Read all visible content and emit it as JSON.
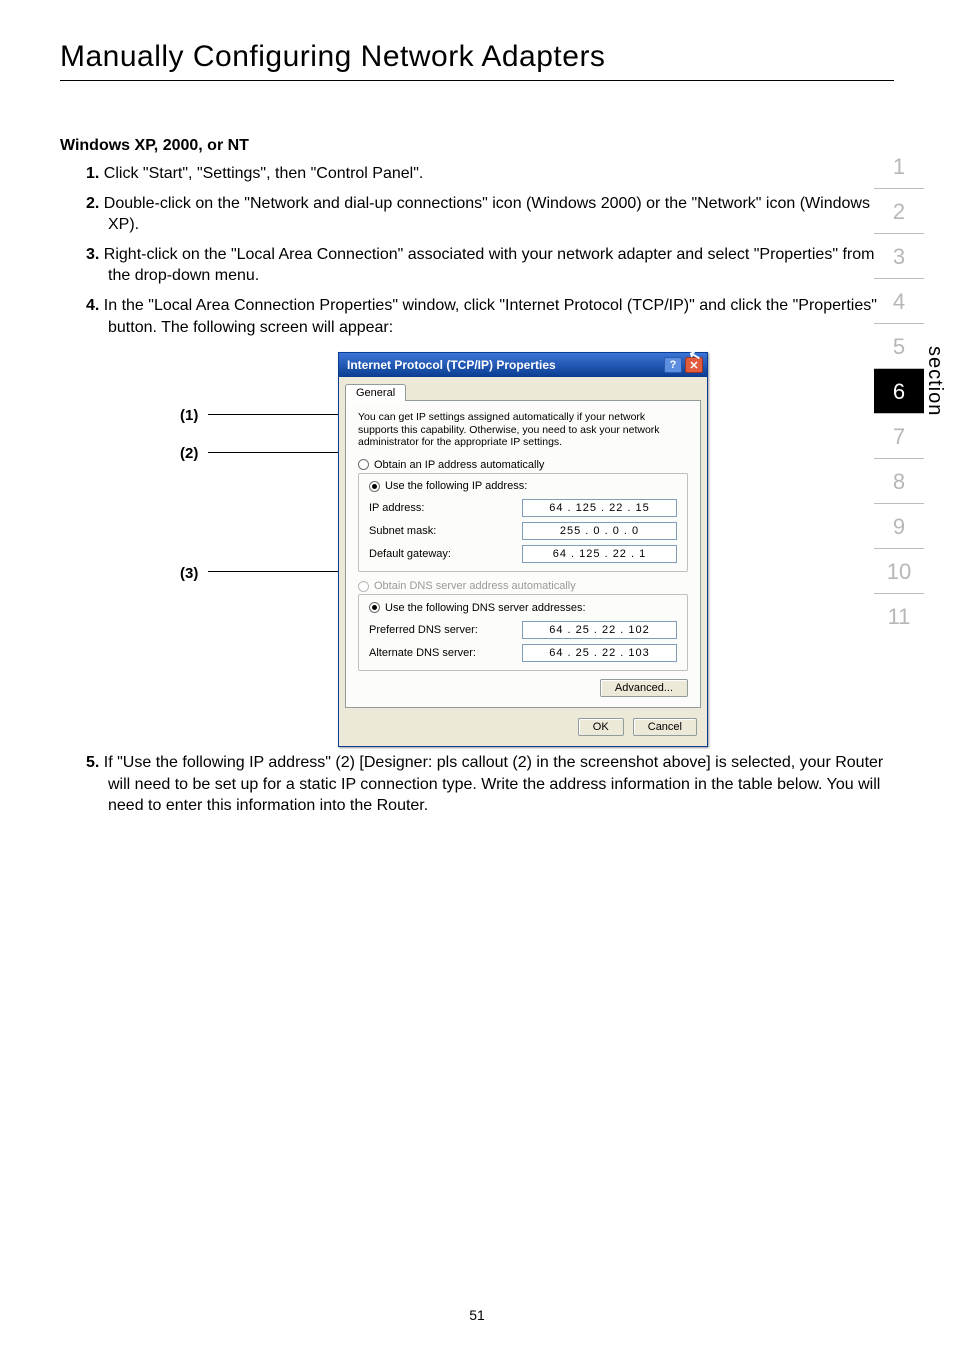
{
  "page_title": "Manually Configuring Network Adapters",
  "subhead": "Windows XP, 2000, or NT",
  "steps": {
    "s1_num": "1.",
    "s1": " Click \"Start\", \"Settings\", then \"Control Panel\".",
    "s2_num": "2.",
    "s2": " Double-click on the \"Network and dial-up connections\" icon (Windows 2000) or the \"Network\" icon (Windows XP).",
    "s3_num": "3.",
    "s3": " Right-click on the \"Local Area Connection\" associated with your network adapter and select \"Properties\" from the drop-down menu.",
    "s4_num": "4.",
    "s4": " In the \"Local Area Connection Properties\" window, click \"Internet Protocol (TCP/IP)\" and click the \"Properties\" button. The following screen will appear:",
    "s5_num": "5.",
    "s5": " If \"Use the following IP address\" (2) [Designer: pls callout (2) in the screenshot above] is selected, your Router will need to be set up for a static IP connection type. Write the address information in the table below. You will need to enter this information into the Router."
  },
  "callouts": {
    "c1": "(1)",
    "c2": "(2)",
    "c3": "(3)"
  },
  "dialog": {
    "title": "Internet Protocol (TCP/IP) Properties",
    "help": "?",
    "close": "✕",
    "tab": "General",
    "descr": "You can get IP settings assigned automatically if your network supports this capability. Otherwise, you need to ask your network administrator for the appropriate IP settings.",
    "r_auto_ip": "Obtain an IP address automatically",
    "r_use_ip": "Use the following IP address:",
    "lbl_ip": "IP address:",
    "val_ip": "64 . 125 . 22 . 15",
    "lbl_mask": "Subnet mask:",
    "val_mask": "255 .  0  .  0  .  0",
    "lbl_gw": "Default gateway:",
    "val_gw": "64 . 125 . 22 .  1",
    "r_auto_dns": "Obtain DNS server address automatically",
    "r_use_dns": "Use the following DNS server addresses:",
    "lbl_pdns": "Preferred DNS server:",
    "val_pdns": "64 . 25 . 22 . 102",
    "lbl_adns": "Alternate DNS server:",
    "val_adns": "64 . 25 . 22 . 103",
    "btn_adv": "Advanced...",
    "btn_ok": "OK",
    "btn_cancel": "Cancel"
  },
  "sidebar": [
    "1",
    "2",
    "3",
    "4",
    "5",
    "6",
    "7",
    "8",
    "9",
    "10",
    "11"
  ],
  "section_label": "section",
  "page_number": "51"
}
